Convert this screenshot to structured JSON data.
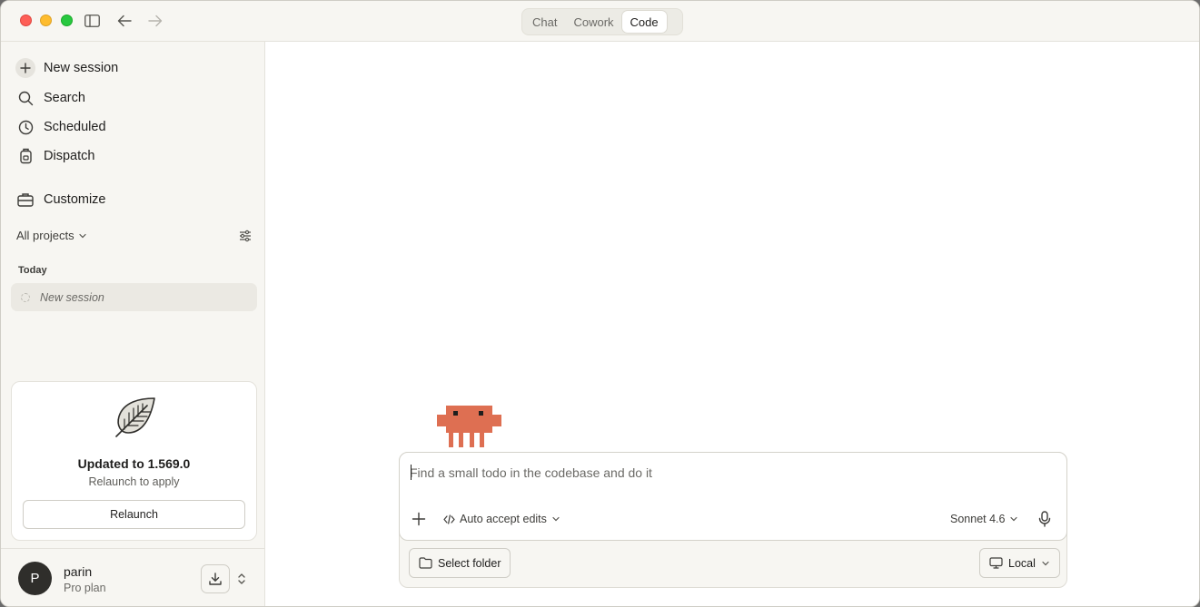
{
  "titlebar": {
    "modes": [
      {
        "label": "Chat",
        "active": false
      },
      {
        "label": "Cowork",
        "active": false
      },
      {
        "label": "Code",
        "active": true
      }
    ]
  },
  "sidebar": {
    "nav": [
      {
        "label": "New session",
        "icon": "plus-icon"
      },
      {
        "label": "Search",
        "icon": "search-icon"
      },
      {
        "label": "Scheduled",
        "icon": "clock-icon"
      },
      {
        "label": "Dispatch",
        "icon": "dispatch-icon"
      },
      {
        "label": "Customize",
        "icon": "briefcase-icon"
      }
    ],
    "projects_filter": "All projects",
    "section_today": "Today",
    "sessions": [
      {
        "label": "New session"
      }
    ],
    "update_card": {
      "title": "Updated to 1.569.0",
      "subtitle": "Relaunch to apply",
      "button": "Relaunch"
    },
    "user": {
      "initial": "P",
      "name": "parin",
      "plan": "Pro plan"
    }
  },
  "composer": {
    "placeholder": "Find a small todo in the codebase and do it",
    "value": "",
    "permission_mode": "Auto accept edits",
    "model": "Sonnet 4.6",
    "select_folder": "Select folder",
    "environment": "Local"
  },
  "colors": {
    "accent_mascot": "#de6f52",
    "sidebar_bg": "#f7f6f2"
  }
}
